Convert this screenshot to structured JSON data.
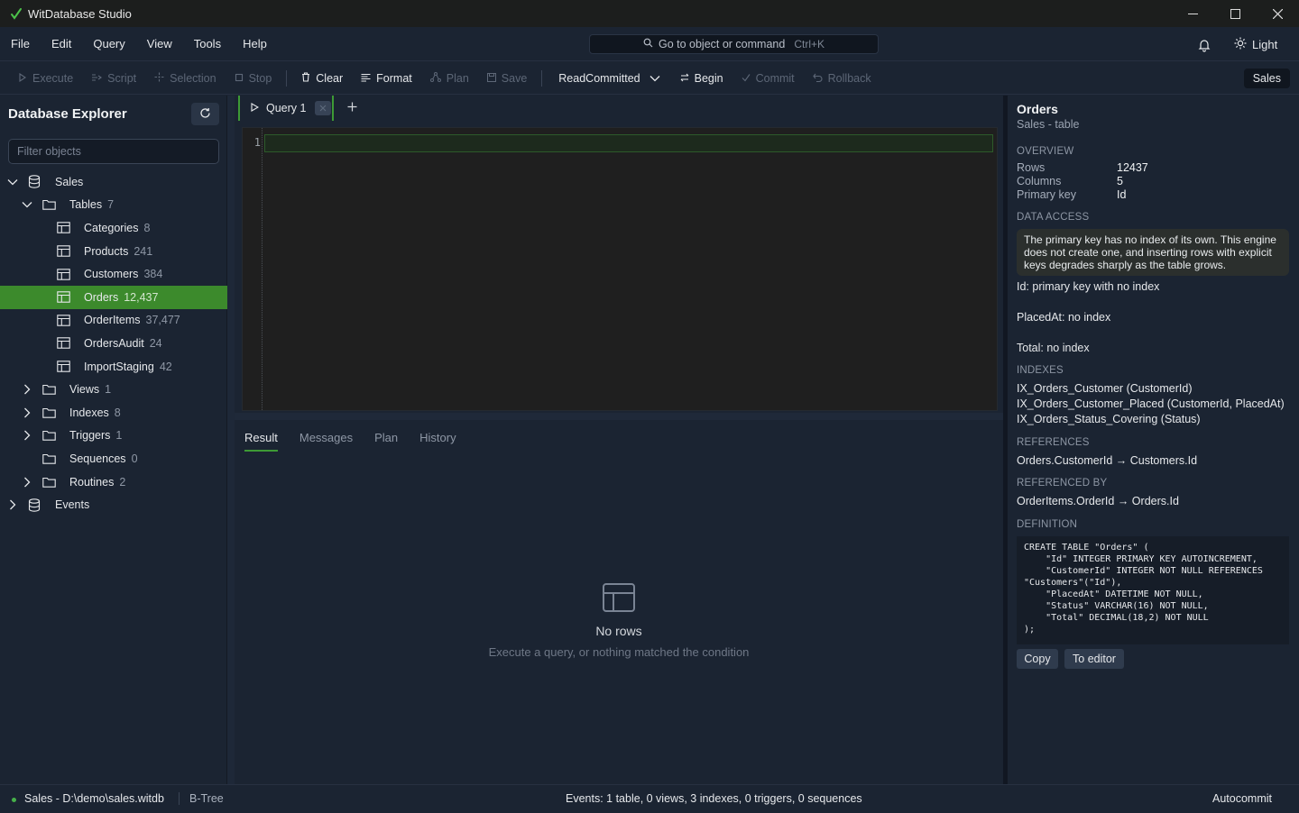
{
  "window": {
    "title": "WitDatabase Studio"
  },
  "menu": [
    "File",
    "Edit",
    "Query",
    "View",
    "Tools",
    "Help"
  ],
  "command_search": {
    "label": "Go to object or command",
    "shortcut": "Ctrl+K"
  },
  "theme_toggle": "Light",
  "toolbar": {
    "execute": "Execute",
    "script": "Script",
    "selection": "Selection",
    "stop": "Stop",
    "clear": "Clear",
    "format": "Format",
    "plan": "Plan",
    "save": "Save",
    "isolation": "ReadCommitted",
    "begin": "Begin",
    "commit": "Commit",
    "rollback": "Rollback",
    "database": "Sales"
  },
  "explorer": {
    "title": "Database Explorer",
    "filter_placeholder": "Filter objects",
    "tree": [
      {
        "label": "Sales",
        "count": "",
        "level": 0,
        "icon": "database-icon",
        "chevron": "down",
        "selected": false
      },
      {
        "label": "Tables",
        "count": "7",
        "level": 1,
        "icon": "folder-icon",
        "chevron": "down",
        "selected": false
      },
      {
        "label": "Categories",
        "count": "8",
        "level": 2,
        "icon": "table-icon",
        "chevron": "",
        "selected": false
      },
      {
        "label": "Products",
        "count": "241",
        "level": 2,
        "icon": "table-icon",
        "chevron": "",
        "selected": false
      },
      {
        "label": "Customers",
        "count": "384",
        "level": 2,
        "icon": "table-icon",
        "chevron": "",
        "selected": false
      },
      {
        "label": "Orders",
        "count": "12,437",
        "level": 2,
        "icon": "table-icon",
        "chevron": "",
        "selected": true
      },
      {
        "label": "OrderItems",
        "count": "37,477",
        "level": 2,
        "icon": "table-icon",
        "chevron": "",
        "selected": false
      },
      {
        "label": "OrdersAudit",
        "count": "24",
        "level": 2,
        "icon": "table-icon",
        "chevron": "",
        "selected": false
      },
      {
        "label": "ImportStaging",
        "count": "42",
        "level": 2,
        "icon": "table-icon",
        "chevron": "",
        "selected": false
      },
      {
        "label": "Views",
        "count": "1",
        "level": 1,
        "icon": "folder-icon",
        "chevron": "right",
        "selected": false
      },
      {
        "label": "Indexes",
        "count": "8",
        "level": 1,
        "icon": "folder-icon",
        "chevron": "right",
        "selected": false
      },
      {
        "label": "Triggers",
        "count": "1",
        "level": 1,
        "icon": "folder-icon",
        "chevron": "right",
        "selected": false
      },
      {
        "label": "Sequences",
        "count": "0",
        "level": 1,
        "icon": "folder-icon",
        "chevron": "",
        "selected": false
      },
      {
        "label": "Routines",
        "count": "2",
        "level": 1,
        "icon": "folder-icon",
        "chevron": "right",
        "selected": false
      },
      {
        "label": "Events",
        "count": "",
        "level": 0,
        "icon": "database-icon",
        "chevron": "right",
        "selected": false
      }
    ]
  },
  "editor": {
    "tab_label": "Query 1",
    "line_number": "1"
  },
  "results": {
    "tabs": [
      "Result",
      "Messages",
      "Plan",
      "History"
    ],
    "active_tab": "Result",
    "empty_title": "No rows",
    "empty_subtitle": "Execute a query, or nothing matched the condition"
  },
  "inspector": {
    "title": "Orders",
    "subtitle": "Sales - table",
    "overview_heading": "OVERVIEW",
    "rows_label": "Rows",
    "rows_value": "12437",
    "columns_label": "Columns",
    "columns_value": "5",
    "pk_label": "Primary key",
    "pk_value": "Id",
    "data_access_heading": "DATA ACCESS",
    "warning": "The primary key has no index of its own. This engine does not create one, and inserting rows with explicit keys degrades sharply as the table grows.",
    "access_items": [
      "Id: primary key with no index",
      "PlacedAt: no index",
      "Total: no index"
    ],
    "indexes_heading": "INDEXES",
    "indexes": [
      "IX_Orders_Customer (CustomerId)",
      "IX_Orders_Customer_Placed (CustomerId, PlacedAt)",
      "IX_Orders_Status_Covering (Status)"
    ],
    "references_heading": "REFERENCES",
    "references": "Orders.CustomerId → Customers.Id",
    "referenced_by_heading": "REFERENCED BY",
    "referenced_by": "OrderItems.OrderId → Orders.Id",
    "definition_heading": "DEFINITION",
    "definition": "CREATE TABLE \"Orders\" (\n    \"Id\" INTEGER PRIMARY KEY AUTOINCREMENT,\n    \"CustomerId\" INTEGER NOT NULL REFERENCES\n\"Customers\"(\"Id\"),\n    \"PlacedAt\" DATETIME NOT NULL,\n    \"Status\" VARCHAR(16) NOT NULL,\n    \"Total\" DECIMAL(18,2) NOT NULL\n);",
    "copy_label": "Copy",
    "to_editor_label": "To editor"
  },
  "status": {
    "connection": "Sales - D:\\demo\\sales.witdb",
    "engine": "B-Tree",
    "summary": "Events: 1 table, 0 views, 3 indexes, 0 triggers, 0 sequences",
    "mode": "Autocommit"
  },
  "colors": {
    "accent": "#3c8a2c",
    "background": "#1b2432",
    "editor_bg": "#1f1f1f",
    "status_ok": "#46b04a"
  }
}
